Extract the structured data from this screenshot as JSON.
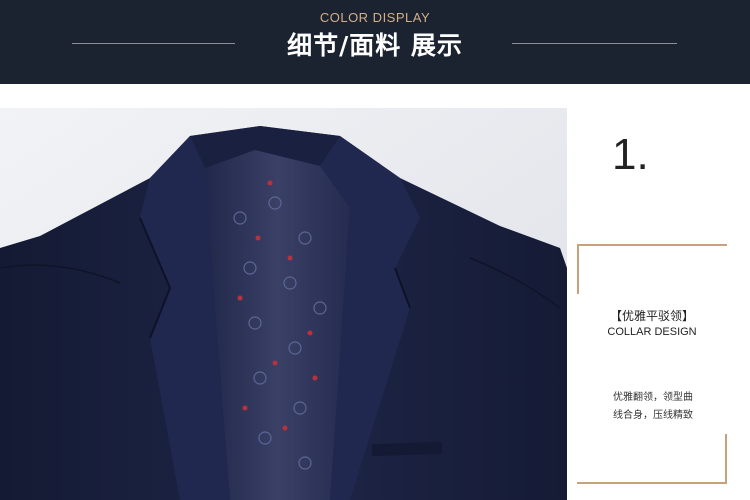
{
  "header": {
    "subtitle": "COLOR DISPLAY",
    "title": "细节/面料 展示"
  },
  "photo": {
    "description_label": "",
    "jacket_color": "#1a2140",
    "lining_color": "#2b3152"
  },
  "feature": {
    "number": "1.",
    "title": "【优雅平驳领】",
    "subtitle": "COLLAR DESIGN",
    "description_line1": "优雅翻领，领型曲",
    "description_line2": "线合身，压线精致"
  },
  "colors": {
    "banner": "#1b2230",
    "accent_gold": "#c7a17a",
    "banner_text": "#ffffff"
  }
}
